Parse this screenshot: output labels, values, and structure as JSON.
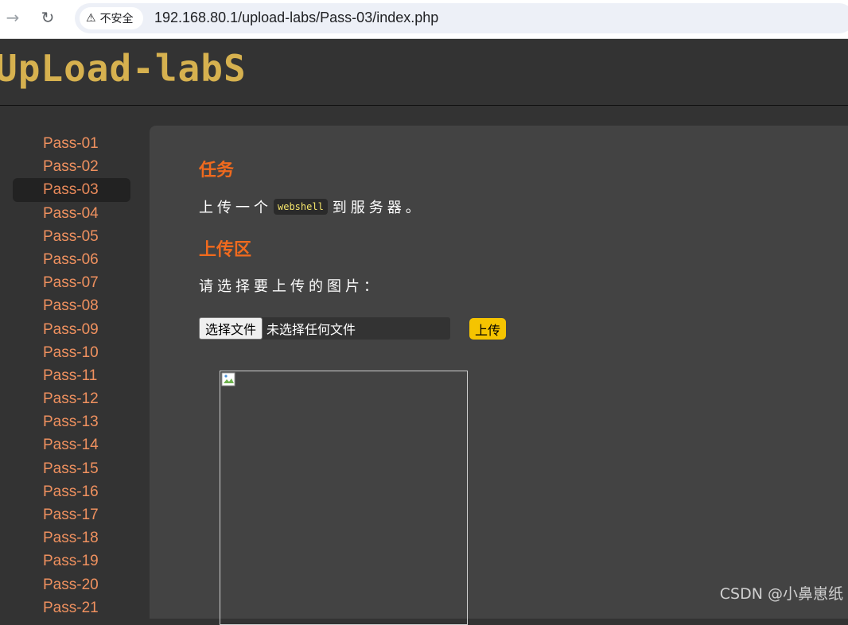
{
  "browser": {
    "back_icon": "arrow-left-icon",
    "reload_icon": "reload-icon",
    "security_label": "不安全",
    "url": "192.168.80.1/upload-labs/Pass-03/index.php"
  },
  "header": {
    "logo": "UpLoad-labS"
  },
  "sidebar": {
    "items": [
      {
        "label": "Pass-01"
      },
      {
        "label": "Pass-02"
      },
      {
        "label": "Pass-03",
        "active": true
      },
      {
        "label": "Pass-04"
      },
      {
        "label": "Pass-05"
      },
      {
        "label": "Pass-06"
      },
      {
        "label": "Pass-07"
      },
      {
        "label": "Pass-08"
      },
      {
        "label": "Pass-09"
      },
      {
        "label": "Pass-10"
      },
      {
        "label": "Pass-11"
      },
      {
        "label": "Pass-12"
      },
      {
        "label": "Pass-13"
      },
      {
        "label": "Pass-14"
      },
      {
        "label": "Pass-15"
      },
      {
        "label": "Pass-16"
      },
      {
        "label": "Pass-17"
      },
      {
        "label": "Pass-18"
      },
      {
        "label": "Pass-19"
      },
      {
        "label": "Pass-20"
      },
      {
        "label": "Pass-21"
      }
    ]
  },
  "main": {
    "task_title": "任务",
    "task_prefix": "上传一个",
    "task_code": "webshell",
    "task_suffix": "到服务器。",
    "upload_title": "上传区",
    "choose_label": "请选择要上传的图片：",
    "file_button": "选择文件",
    "file_status": "未选择任何文件",
    "upload_button": "上传"
  },
  "watermark": "CSDN @小鼻崽纸",
  "colors": {
    "accent": "#f06a1e",
    "sidebar_link": "#f0915f",
    "upload_button": "#f5c400",
    "logo": "#d6b14f"
  }
}
